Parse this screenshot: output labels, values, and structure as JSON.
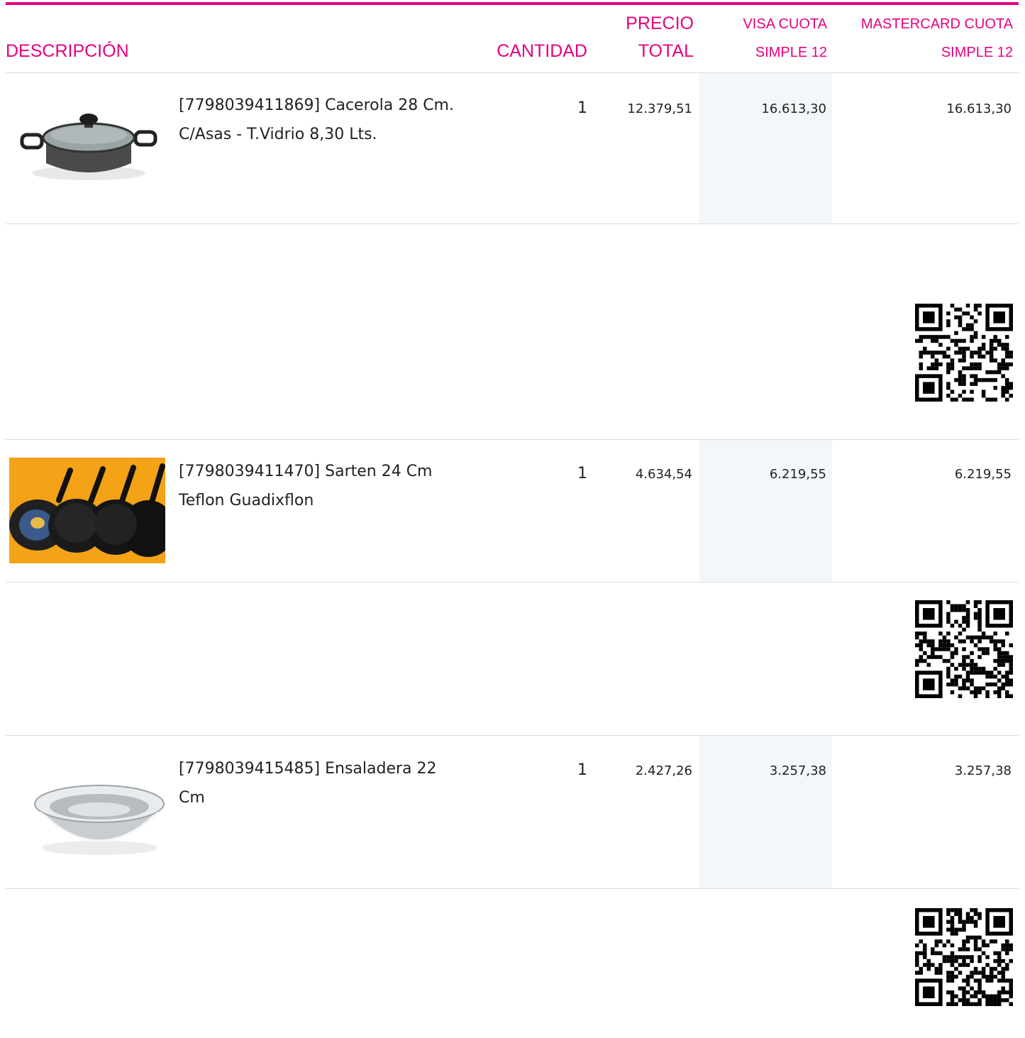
{
  "header": {
    "descripcion": "DESCRIPCIÓN",
    "cantidad": "CANTIDAD",
    "precio_line1": "PRECIO",
    "precio_line2": "TOTAL",
    "visa_line1": "VISA CUOTA",
    "visa_line2": "SIMPLE 12",
    "master_line1": "MASTERCARD CUOTA",
    "master_line2": "SIMPLE 12"
  },
  "accent_color": "#e6007e",
  "products": [
    {
      "desc_line1": "[7798039411869] Cacerola 28 Cm.",
      "desc_line2": "C/Asas - T.Vidrio 8,30 Lts.",
      "quantity": "1",
      "precio_total": "12.379,51",
      "visa": "16.613,30",
      "mastercard": "16.613,30",
      "image": "pot-with-glass-lid-image"
    },
    {
      "desc_line1": "[7798039411470] Sarten 24 Cm",
      "desc_line2": "Teflon Guadixflon",
      "quantity": "1",
      "precio_total": "4.634,54",
      "visa": "6.219,55",
      "mastercard": "6.219,55",
      "image": "frying-pans-image"
    },
    {
      "desc_line1": "[7798039415485] Ensaladera 22",
      "desc_line2": "Cm",
      "quantity": "1",
      "precio_total": "2.427,26",
      "visa": "3.257,38",
      "mastercard": "3.257,38",
      "image": "steel-salad-bowl-image"
    }
  ]
}
